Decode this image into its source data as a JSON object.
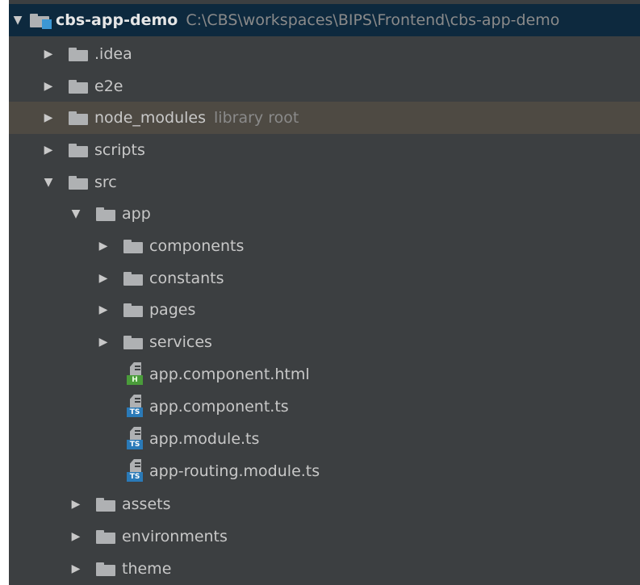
{
  "tree": {
    "root": {
      "label": "cbs-app-demo",
      "path": "C:\\CBS\\workspaces\\BIPS\\Frontend\\cbs-app-demo",
      "arrow": "▼"
    },
    "items": [
      {
        "label": ".idea",
        "arrow": "▶"
      },
      {
        "label": "e2e",
        "arrow": "▶"
      },
      {
        "label": "node_modules",
        "hint": "library root",
        "arrow": "▶"
      },
      {
        "label": "scripts",
        "arrow": "▶"
      },
      {
        "label": "src",
        "arrow": "▼"
      },
      {
        "label": "app",
        "arrow": "▼"
      },
      {
        "label": "components",
        "arrow": "▶"
      },
      {
        "label": "constants",
        "arrow": "▶"
      },
      {
        "label": "pages",
        "arrow": "▶"
      },
      {
        "label": "services",
        "arrow": "▶"
      },
      {
        "label": "app.component.html",
        "badge": "H"
      },
      {
        "label": "app.component.ts",
        "badge": "TS"
      },
      {
        "label": "app.module.ts",
        "badge": "TS"
      },
      {
        "label": "app-routing.module.ts",
        "badge": "TS"
      },
      {
        "label": "assets",
        "arrow": "▶"
      },
      {
        "label": "environments",
        "arrow": "▶"
      },
      {
        "label": "theme",
        "arrow": "▶"
      }
    ]
  },
  "colors": {
    "background": "#3c3f41",
    "selected_row": "#0d293e",
    "hover_row": "#4e4a43",
    "html_badge": "#4a9c3a",
    "ts_badge": "#2a7ab8",
    "module_tag": "#3c97d4"
  }
}
